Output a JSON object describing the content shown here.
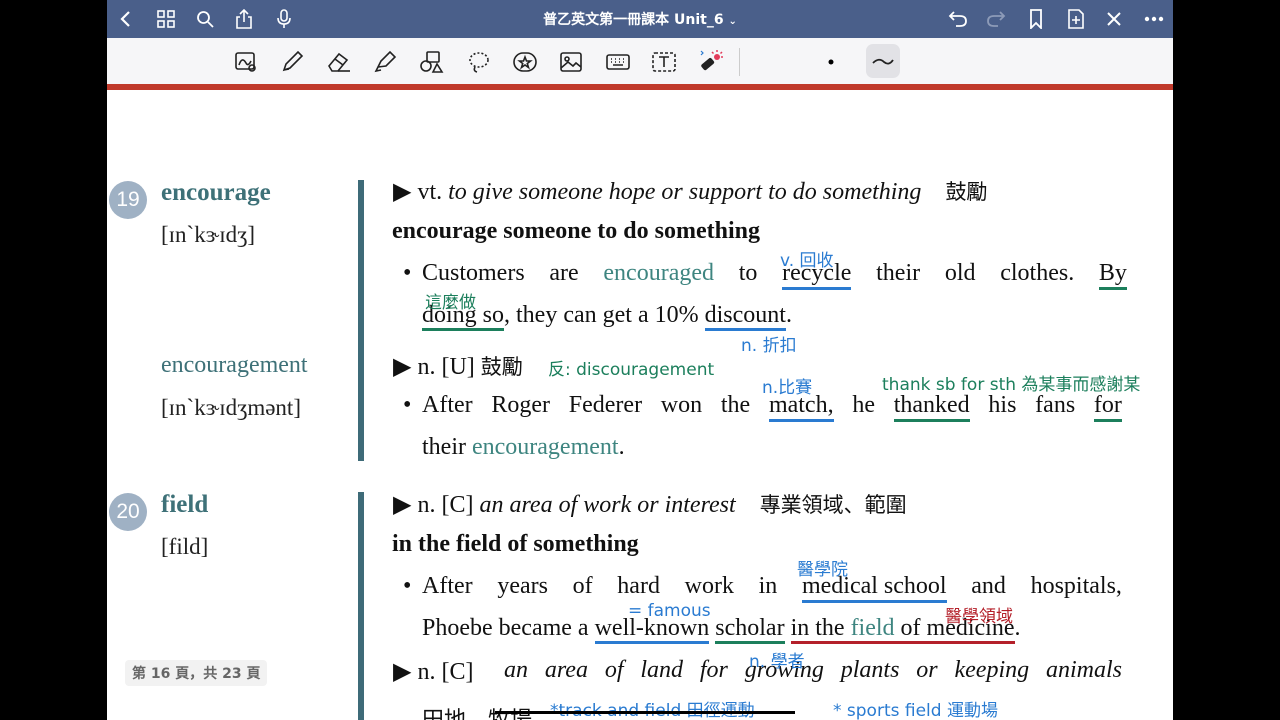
{
  "titlebar": {
    "title": "普乙英文第一冊課本 Unit_6"
  },
  "toolbar": {
    "icons": [
      "lasso-image-icon",
      "pen-icon",
      "eraser-icon",
      "highlighter-icon",
      "shapes-icon",
      "lasso-icon",
      "sticker-icon",
      "image-icon",
      "keyboard-icon",
      "text-box-icon",
      "laser-pointer-icon",
      "color-dot-icon",
      "stroke-width-icon"
    ]
  },
  "entries": [
    {
      "number": "19",
      "headword": "encourage",
      "ipa": "[ɪn`kɝɪdʒ]",
      "derivative": "encouragement",
      "derivative_ipa": "[ɪn`kɝɪdʒmənt]",
      "def1_marker": "▶",
      "def1_pos": "vt.",
      "def1_text": "to give someone hope or support to do something",
      "def1_zh": "鼓勵",
      "phrase": "encourage someone to do something",
      "ex1_parts": [
        "Customers",
        "are",
        "encouraged",
        "to",
        "recycle",
        "their",
        "old",
        "clothes.",
        "By"
      ],
      "ex1_line2_a": "doing so",
      "ex1_line2_b": ", they can get a 10% ",
      "ex1_line2_c": "discount",
      "ex1_line2_d": ".",
      "def2_pos": "n. [U]",
      "def2_zh": "鼓勵",
      "ex2_parts": [
        "After",
        "Roger",
        "Federer",
        "won",
        "the",
        "match,",
        "he",
        "thanked",
        "his",
        "fans",
        "for"
      ],
      "ex2_line2_a": "their ",
      "ex2_line2_b": "encouragement",
      "ex2_line2_c": "."
    },
    {
      "number": "20",
      "headword": "field",
      "ipa": "[fild]",
      "def1_pos": "n. [C]",
      "def1_text": "an area of work or interest",
      "def1_zh": "專業領域、範圍",
      "phrase": "in the field of something",
      "ex1_parts": [
        "After",
        "years",
        "of",
        "hard",
        "work",
        "in",
        "medical school",
        "and",
        "hospitals,"
      ],
      "ex1_line2_a": "Phoebe became a ",
      "ex1_line2_b": "well-known",
      "ex1_line2_c": " ",
      "ex1_line2_d": "scholar",
      "ex1_line2_e": " ",
      "ex1_line2_f": "in the ",
      "ex1_line2_g": "field",
      "ex1_line2_h": " of medicine",
      "ex1_line2_i": ".",
      "def2_pos": "n. [C]",
      "def2_parts": [
        "an",
        "area",
        "of",
        "land",
        "for",
        "growing",
        "plants",
        "or",
        "keeping",
        "animals"
      ],
      "def2_zh": "田地，牧場"
    }
  ],
  "bullet": "•",
  "annotations": {
    "recycle_note": "v. 回收",
    "doing_so_note": "這麼做",
    "discount_note": "n. 折扣",
    "antonym_note": "反: discouragement",
    "match_note": "n.比賽",
    "thank_note": "thank sb for sth 為某事而感謝某",
    "medical_school_note": "醫學院",
    "famous_note": "= famous",
    "field_medicine_note": "醫學領域",
    "scholar_note": "n. 學者",
    "track_note": "*track and field 田徑運動",
    "sports_note": "* sports field 運動場"
  },
  "page_indicator": "第 16 頁，共 23 頁",
  "colors": {
    "titlebar": "#4a5f8a",
    "accent_red": "#c0392b",
    "teal": "#3e7178",
    "note_blue": "#2a7bd1",
    "note_green": "#1c7f5c",
    "note_red": "#b4202a"
  }
}
